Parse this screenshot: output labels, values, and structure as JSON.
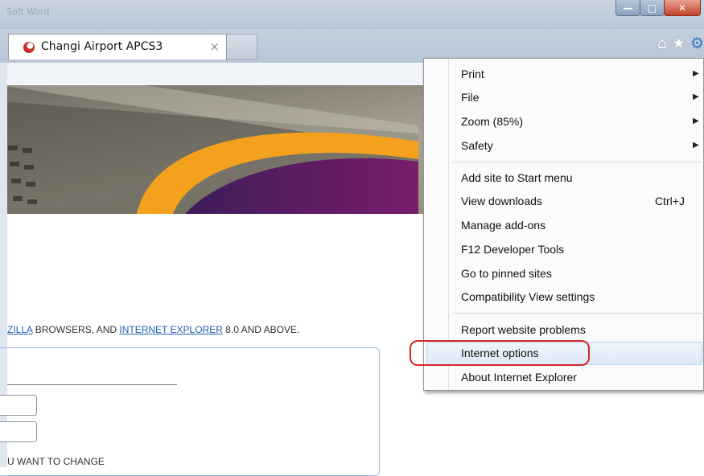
{
  "window": {
    "title_faint": "Soft Word",
    "buttons": {
      "minimize": "—",
      "maximize": "□",
      "close": "✕"
    }
  },
  "tab": {
    "title": "Changi Airport APCS3",
    "close": "×"
  },
  "toolbar_icons": [
    "home-icon",
    "star-icon",
    "gear-icon"
  ],
  "page": {
    "notice_prefix": "ZILLA",
    "notice_mid": " BROWSERS, AND ",
    "notice_link": "INTERNET EXPLORER",
    "notice_suffix": " 8.0 AND ABOVE.",
    "change_text": "U WANT TO CHANGE"
  },
  "menu": {
    "items": [
      {
        "label": "Print",
        "submenu": true
      },
      {
        "label": "File",
        "submenu": true
      },
      {
        "label": "Zoom (85%)",
        "submenu": true
      },
      {
        "label": "Safety",
        "submenu": true
      },
      {
        "label": "Add site to Start menu"
      },
      {
        "label": "View downloads",
        "shortcut": "Ctrl+J"
      },
      {
        "label": "Manage add-ons"
      },
      {
        "label": "F12 Developer Tools"
      },
      {
        "label": "Go to pinned sites"
      },
      {
        "label": "Compatibility View settings"
      },
      {
        "label": "Report website problems"
      },
      {
        "label": "Internet options",
        "highlighted": true
      },
      {
        "label": "About Internet Explorer"
      }
    ]
  },
  "colors": {
    "callout": "#d62828",
    "hero_orange": "#f4a21e",
    "hero_purple": "#5e1a6e",
    "link_blue": "#1f5fb0"
  }
}
